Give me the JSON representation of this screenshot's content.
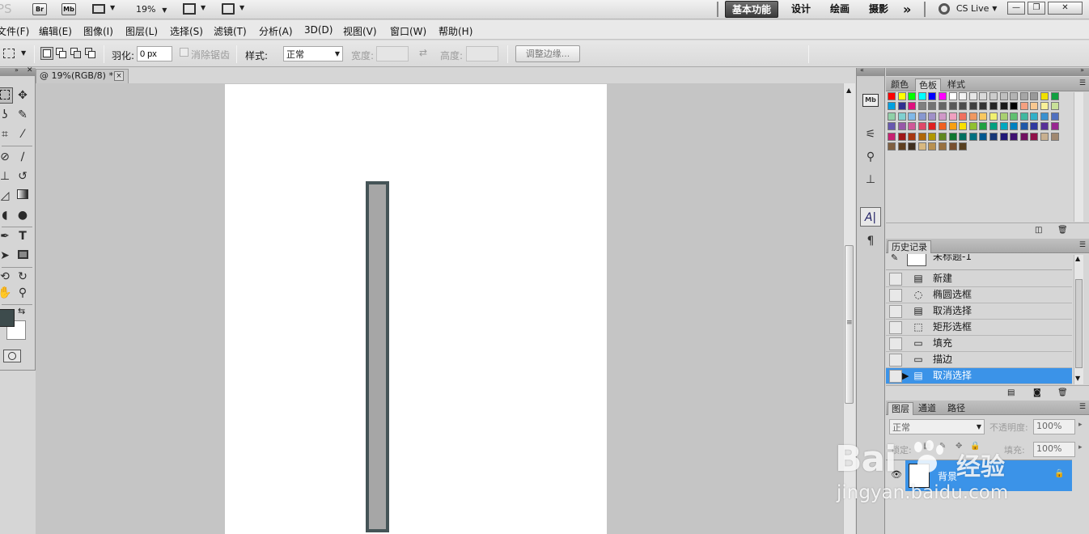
{
  "app": {
    "logo_text": "PS",
    "bridge_label": "Br",
    "minibridge_label": "Mb",
    "zoom_label": "19%",
    "workspaces": [
      "基本功能",
      "设计",
      "绘画",
      "摄影"
    ],
    "more_symbol": "»",
    "cs_live": "CS Live",
    "window_controls": [
      "—",
      "❐",
      "✕"
    ]
  },
  "menu": [
    "文件(F)",
    "编辑(E)",
    "图像(I)",
    "图层(L)",
    "选择(S)",
    "滤镜(T)",
    "分析(A)",
    "3D(D)",
    "视图(V)",
    "窗口(W)",
    "帮助(H)"
  ],
  "options": {
    "feather_label": "羽化:",
    "feather_value": "0 px",
    "antialias_label": "消除锯齿",
    "style_label": "样式:",
    "style_value": "正常",
    "width_label": "宽度:",
    "height_label": "高度:",
    "refine_edge": "调整边缘..."
  },
  "document": {
    "tab_title": "@ 19%(RGB/8) *",
    "close_symbol": "×"
  },
  "colors": {
    "foreground": "#3d4b4c",
    "background": "#ffffff",
    "selection": "#3b93e8",
    "shape_fill": "#a6a6a6",
    "shape_stroke": "#455457"
  },
  "swatch_panel": {
    "tabs": [
      "颜色",
      "色板",
      "样式"
    ],
    "active_tab": "色板"
  },
  "history_panel": {
    "title": "历史记录",
    "snapshot_label": "未标题-1",
    "items": [
      "新建",
      "椭圆选框",
      "取消选择",
      "矩形选框",
      "填充",
      "描边",
      "取消选择"
    ],
    "item_icons": [
      "doc-icon",
      "ellipse-marquee-icon",
      "doc-icon",
      "rect-marquee-icon",
      "fill-icon",
      "fill-icon",
      "doc-icon"
    ],
    "selected_index": 6
  },
  "layers_panel": {
    "tabs": [
      "图层",
      "通道",
      "路径"
    ],
    "blend_mode": "正常",
    "opacity_label": "不透明度:",
    "opacity_value": "100%",
    "lock_label": "锁定:",
    "fill_label": "填充:",
    "fill_value": "100%",
    "layer_name": "背景"
  },
  "watermark": {
    "brand": "Bai",
    "brand_tail": "经验",
    "url": "jingyan.baidu.com"
  }
}
